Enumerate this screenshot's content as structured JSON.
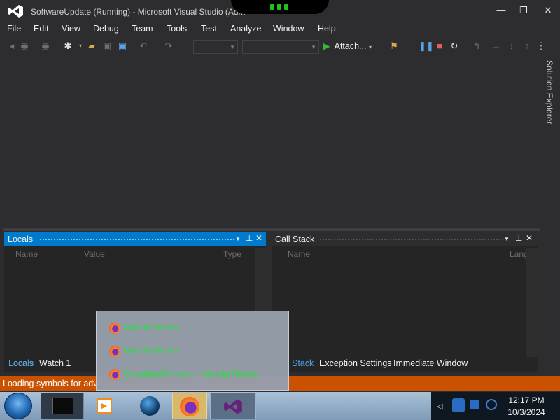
{
  "window": {
    "title": "SoftwareUpdate (Running) - Microsoft Visual Studio (Adm",
    "controls": {
      "minimize": "—",
      "restore": "❐",
      "close": "✕"
    }
  },
  "menu": [
    "File",
    "Edit",
    "View",
    "Debug",
    "Team",
    "Tools",
    "Test",
    "Analyze",
    "Window",
    "Help"
  ],
  "toolbar": {
    "attach_label": "Attach..."
  },
  "side_tab": {
    "label": "Solution Explorer"
  },
  "locals_panel": {
    "title": "Locals",
    "columns": [
      "Name",
      "Value",
      "Type"
    ]
  },
  "callstack_panel": {
    "title": "Call Stack",
    "columns": [
      "Name",
      "Lang"
    ]
  },
  "bottom_tabs_left": [
    "Locals",
    "Watch 1"
  ],
  "bottom_tabs_right": [
    "Stack",
    "Exception Settings",
    "Immediate Window"
  ],
  "status": {
    "text": "Loading symbols for adva"
  },
  "popup": {
    "items": [
      "Mozilla Firefox",
      "Mozilla Firefox",
      "Download Roblox — Mozilla Firefox"
    ]
  },
  "clock": {
    "time": "12:17 PM",
    "date": "10/3/2024"
  },
  "colors": {
    "accent": "#007acc",
    "status_bar": "#ca5100",
    "popup_text": "#22e33b"
  }
}
